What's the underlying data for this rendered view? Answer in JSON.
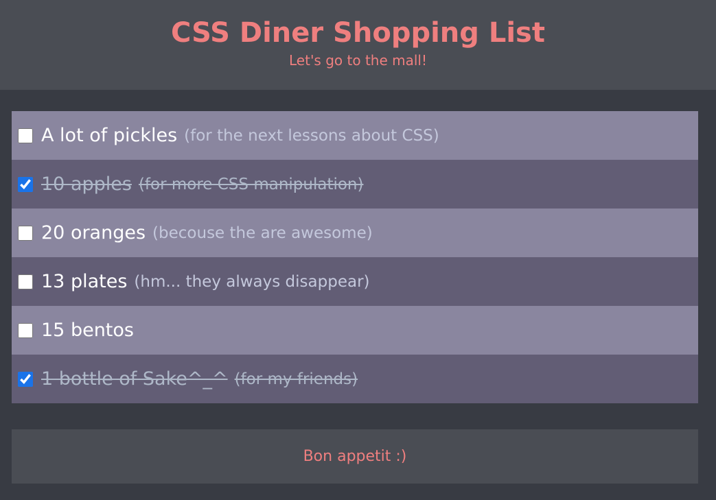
{
  "header": {
    "title": "CSS Diner Shopping List",
    "subtitle": "Let's go to the mall!"
  },
  "items": [
    {
      "label": "A lot of pickles",
      "note": "(for the next lessons about CSS)",
      "checked": false
    },
    {
      "label": "10 apples",
      "note": "(for more CSS manipulation)",
      "checked": true
    },
    {
      "label": "20 oranges",
      "note": "(becouse the are awesome)",
      "checked": false
    },
    {
      "label": "13 plates",
      "note": "(hm... they always disappear)",
      "checked": false
    },
    {
      "label": "15 bentos",
      "note": "",
      "checked": false
    },
    {
      "label": "1 bottle of Sake^_^",
      "note": "(for my friends)",
      "checked": true
    }
  ],
  "footer": {
    "text": "Bon appetit :)"
  },
  "colors": {
    "background": "#383b43",
    "panel": "#4a4d54",
    "accent": "#ef7f7f",
    "row_light": "#8a869f",
    "row_dark": "#625d75",
    "checkbox_checked": "#1a73e8"
  }
}
